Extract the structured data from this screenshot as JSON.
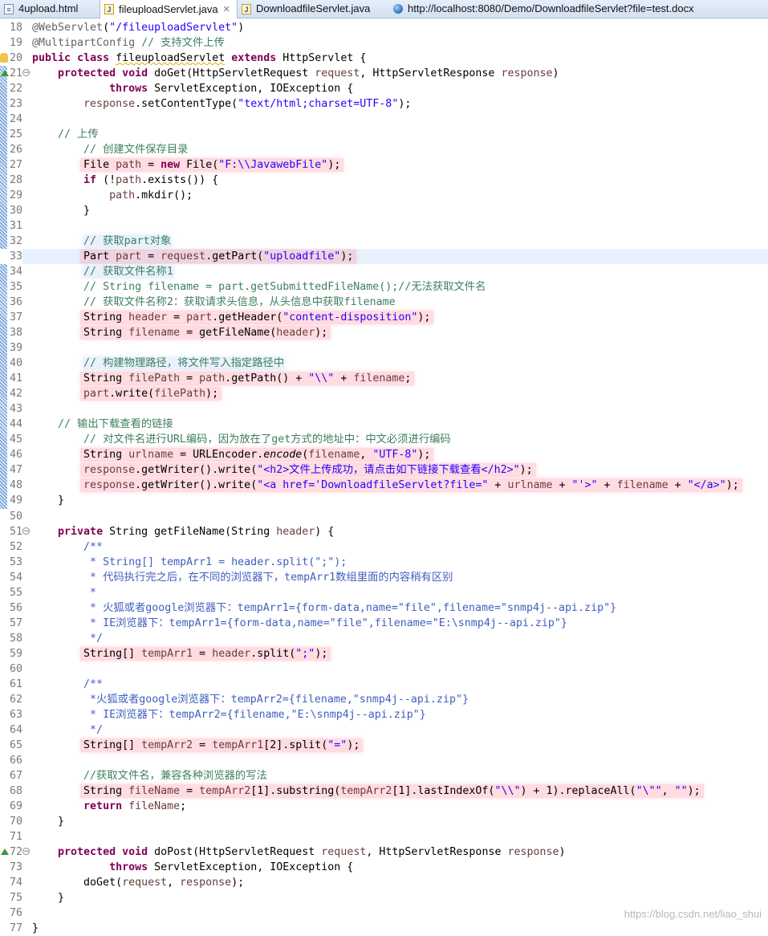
{
  "tabs": [
    {
      "label": "4upload.html",
      "icon": "html-file-icon"
    },
    {
      "label": "fileuploadServlet.java",
      "icon": "java-file-icon",
      "active": true,
      "close": "✕"
    },
    {
      "label": "DownloadfileServlet.java",
      "icon": "java-file-icon"
    },
    {
      "label": "http://localhost:8080/Demo/DownloadfileServlet?file=test.docx",
      "icon": "globe-icon"
    }
  ],
  "editor": {
    "current_line": 33,
    "lines": [
      {
        "no": 18,
        "t": [
          [
            "a",
            "@WebServlet"
          ],
          [
            "n",
            "("
          ],
          [
            "s",
            "\"/fileuploadServlet\""
          ],
          [
            "n",
            ")"
          ]
        ]
      },
      {
        "no": 19,
        "t": [
          [
            "a",
            "@MultipartConfig"
          ],
          [
            "n",
            " "
          ],
          [
            "c",
            "// 支持文件上传"
          ]
        ]
      },
      {
        "no": 20,
        "t": [
          [
            "k",
            "public"
          ],
          [
            "n",
            " "
          ],
          [
            "k",
            "class"
          ],
          [
            "n",
            " "
          ],
          [
            "u",
            "fileuploadServlet"
          ],
          [
            "n",
            " "
          ],
          [
            "k",
            "extends"
          ],
          [
            "n",
            " HttpServlet {"
          ]
        ]
      },
      {
        "no": 21,
        "t": [
          [
            "n",
            "    "
          ],
          [
            "k",
            "protected"
          ],
          [
            "n",
            " "
          ],
          [
            "k",
            "void"
          ],
          [
            "n",
            " doGet(HttpServletRequest "
          ],
          [
            "v",
            "request"
          ],
          [
            "n",
            ", HttpServletResponse "
          ],
          [
            "v",
            "response"
          ],
          [
            "n",
            ")"
          ]
        ]
      },
      {
        "no": 22,
        "t": [
          [
            "n",
            "            "
          ],
          [
            "k",
            "throws"
          ],
          [
            "n",
            " ServletException, IOException {"
          ]
        ]
      },
      {
        "no": 23,
        "t": [
          [
            "n",
            "        "
          ],
          [
            "v",
            "response"
          ],
          [
            "n",
            ".setContentType("
          ],
          [
            "s",
            "\"text/html;charset=UTF-8\""
          ],
          [
            "n",
            ");"
          ]
        ]
      },
      {
        "no": 24,
        "t": []
      },
      {
        "no": 25,
        "t": [
          [
            "n",
            "    "
          ],
          [
            "c",
            "// 上传"
          ]
        ]
      },
      {
        "no": 26,
        "t": [
          [
            "n",
            "        "
          ],
          [
            "c",
            "// 创建文件保存目录"
          ]
        ]
      },
      {
        "no": 27,
        "t": [
          [
            "n",
            "        "
          ],
          [
            "H",
            ""
          ],
          [
            "n",
            "File "
          ],
          [
            "v",
            "path"
          ],
          [
            "n",
            " = "
          ],
          [
            "k",
            "new"
          ],
          [
            "n",
            " File("
          ],
          [
            "s",
            "\"F:\\\\JavawebFile\""
          ],
          [
            "n",
            ");"
          ]
        ]
      },
      {
        "no": 28,
        "t": [
          [
            "n",
            "        "
          ],
          [
            "k",
            "if"
          ],
          [
            "n",
            " (!"
          ],
          [
            "v",
            "path"
          ],
          [
            "n",
            ".exists()) {"
          ]
        ]
      },
      {
        "no": 29,
        "t": [
          [
            "n",
            "            "
          ],
          [
            "v",
            "path"
          ],
          [
            "n",
            ".mkdir();"
          ]
        ]
      },
      {
        "no": 30,
        "t": [
          [
            "n",
            "        }"
          ]
        ]
      },
      {
        "no": 31,
        "t": []
      },
      {
        "no": 32,
        "t": [
          [
            "n",
            "        "
          ],
          [
            "G",
            ""
          ],
          [
            "c",
            "// 获取part对象"
          ]
        ]
      },
      {
        "no": 33,
        "t": [
          [
            "n",
            "        "
          ],
          [
            "H",
            ""
          ],
          [
            "n",
            "Part "
          ],
          [
            "v",
            "part"
          ],
          [
            "n",
            " = "
          ],
          [
            "v",
            "request"
          ],
          [
            "n",
            ".getPart("
          ],
          [
            "s",
            "\"uploadfile\""
          ],
          [
            "n",
            ");"
          ]
        ]
      },
      {
        "no": 34,
        "t": [
          [
            "n",
            "        "
          ],
          [
            "G",
            ""
          ],
          [
            "c",
            "// 获取文件名称1"
          ]
        ]
      },
      {
        "no": 35,
        "t": [
          [
            "n",
            "        "
          ],
          [
            "c",
            "// String filename = part.getSubmittedFileName();//无法获取文件名"
          ]
        ]
      },
      {
        "no": 36,
        "t": [
          [
            "n",
            "        "
          ],
          [
            "c",
            "// 获取文件名称2：获取请求头信息，从头信息中获取filename"
          ]
        ]
      },
      {
        "no": 37,
        "t": [
          [
            "n",
            "        "
          ],
          [
            "H",
            ""
          ],
          [
            "n",
            "String "
          ],
          [
            "v",
            "header"
          ],
          [
            "n",
            " = "
          ],
          [
            "v",
            "part"
          ],
          [
            "n",
            ".getHeader("
          ],
          [
            "s",
            "\"content-disposition\""
          ],
          [
            "n",
            ");"
          ]
        ]
      },
      {
        "no": 38,
        "t": [
          [
            "n",
            "        "
          ],
          [
            "H",
            ""
          ],
          [
            "n",
            "String "
          ],
          [
            "v",
            "filename"
          ],
          [
            "n",
            " = getFileName("
          ],
          [
            "v",
            "header"
          ],
          [
            "n",
            ");"
          ]
        ]
      },
      {
        "no": 39,
        "t": []
      },
      {
        "no": 40,
        "t": [
          [
            "n",
            "        "
          ],
          [
            "G",
            ""
          ],
          [
            "c",
            "// 构建物理路径，将文件写入指定路径中"
          ]
        ]
      },
      {
        "no": 41,
        "t": [
          [
            "n",
            "        "
          ],
          [
            "H",
            ""
          ],
          [
            "n",
            "String "
          ],
          [
            "v",
            "filePath"
          ],
          [
            "n",
            " = "
          ],
          [
            "v",
            "path"
          ],
          [
            "n",
            ".getPath() + "
          ],
          [
            "s",
            "\"\\\\\""
          ],
          [
            "n",
            " + "
          ],
          [
            "v",
            "filename"
          ],
          [
            "n",
            ";"
          ]
        ]
      },
      {
        "no": 42,
        "t": [
          [
            "n",
            "        "
          ],
          [
            "H",
            ""
          ],
          [
            "v",
            "part"
          ],
          [
            "n",
            ".write("
          ],
          [
            "v",
            "filePath"
          ],
          [
            "n",
            ");"
          ]
        ]
      },
      {
        "no": 43,
        "t": []
      },
      {
        "no": 44,
        "t": [
          [
            "n",
            "    "
          ],
          [
            "c",
            "// 输出下载查看的链接"
          ]
        ]
      },
      {
        "no": 45,
        "t": [
          [
            "n",
            "        "
          ],
          [
            "c",
            "// 对文件名进行URL编码，因为放在了get方式的地址中：中文必须进行编码"
          ]
        ]
      },
      {
        "no": 46,
        "t": [
          [
            "n",
            "        "
          ],
          [
            "H",
            ""
          ],
          [
            "n",
            "String "
          ],
          [
            "v",
            "urlname"
          ],
          [
            "n",
            " = URLEncoder."
          ],
          [
            "i",
            "encode"
          ],
          [
            "n",
            "("
          ],
          [
            "v",
            "filename"
          ],
          [
            "n",
            ", "
          ],
          [
            "s",
            "\"UTF-8\""
          ],
          [
            "n",
            ");"
          ]
        ]
      },
      {
        "no": 47,
        "t": [
          [
            "n",
            "        "
          ],
          [
            "H",
            ""
          ],
          [
            "v",
            "response"
          ],
          [
            "n",
            ".getWriter().write("
          ],
          [
            "s",
            "\"<h2>文件上传成功，请点击如下链接下载查看</h2>\""
          ],
          [
            "n",
            ");"
          ]
        ]
      },
      {
        "no": 48,
        "t": [
          [
            "n",
            "        "
          ],
          [
            "H",
            ""
          ],
          [
            "v",
            "response"
          ],
          [
            "n",
            ".getWriter().write("
          ],
          [
            "s",
            "\"<a href='DownloadfileServlet?file=\""
          ],
          [
            "n",
            " + "
          ],
          [
            "v",
            "urlname"
          ],
          [
            "n",
            " + "
          ],
          [
            "s",
            "\"'>\""
          ],
          [
            "n",
            " + "
          ],
          [
            "v",
            "filename"
          ],
          [
            "n",
            " + "
          ],
          [
            "s",
            "\"</a>\""
          ],
          [
            "n",
            ");"
          ]
        ]
      },
      {
        "no": 49,
        "t": [
          [
            "n",
            "    }"
          ]
        ]
      },
      {
        "no": 50,
        "t": []
      },
      {
        "no": 51,
        "t": [
          [
            "n",
            "    "
          ],
          [
            "k",
            "private"
          ],
          [
            "n",
            " String getFileName(String "
          ],
          [
            "v",
            "header"
          ],
          [
            "n",
            ") {"
          ]
        ]
      },
      {
        "no": 52,
        "t": [
          [
            "n",
            "        "
          ],
          [
            "d",
            "/**"
          ]
        ]
      },
      {
        "no": 53,
        "t": [
          [
            "n",
            "        "
          ],
          [
            "d",
            " * String[] tempArr1 = header.split(\";\");"
          ]
        ]
      },
      {
        "no": 54,
        "t": [
          [
            "n",
            "        "
          ],
          [
            "d",
            " * 代码执行完之后，在不同的浏览器下，tempArr1数组里面的内容稍有区别"
          ]
        ]
      },
      {
        "no": 55,
        "t": [
          [
            "n",
            "        "
          ],
          [
            "d",
            " *"
          ]
        ]
      },
      {
        "no": 56,
        "t": [
          [
            "n",
            "        "
          ],
          [
            "d",
            " * 火狐或者google浏览器下：tempArr1={form-data,name=\"file\",filename=\"snmp4j--api.zip\"}"
          ]
        ]
      },
      {
        "no": 57,
        "t": [
          [
            "n",
            "        "
          ],
          [
            "d",
            " * IE浏览器下：tempArr1={form-data,name=\"file\",filename=\"E:\\snmp4j--api.zip\"}"
          ]
        ]
      },
      {
        "no": 58,
        "t": [
          [
            "n",
            "        "
          ],
          [
            "d",
            " */"
          ]
        ]
      },
      {
        "no": 59,
        "t": [
          [
            "n",
            "        "
          ],
          [
            "H",
            ""
          ],
          [
            "n",
            "String[] "
          ],
          [
            "v",
            "tempArr1"
          ],
          [
            "n",
            " = "
          ],
          [
            "v",
            "header"
          ],
          [
            "n",
            ".split("
          ],
          [
            "s",
            "\";\""
          ],
          [
            "n",
            ");"
          ]
        ]
      },
      {
        "no": 60,
        "t": []
      },
      {
        "no": 61,
        "t": [
          [
            "n",
            "        "
          ],
          [
            "d",
            "/**"
          ]
        ]
      },
      {
        "no": 62,
        "t": [
          [
            "n",
            "        "
          ],
          [
            "d",
            " *火狐或者google浏览器下：tempArr2={filename,\"snmp4j--api.zip\"}"
          ]
        ]
      },
      {
        "no": 63,
        "t": [
          [
            "n",
            "        "
          ],
          [
            "d",
            " * IE浏览器下：tempArr2={filename,\"E:\\snmp4j--api.zip\"}"
          ]
        ]
      },
      {
        "no": 64,
        "t": [
          [
            "n",
            "        "
          ],
          [
            "d",
            " */"
          ]
        ]
      },
      {
        "no": 65,
        "t": [
          [
            "n",
            "        "
          ],
          [
            "H",
            ""
          ],
          [
            "n",
            "String[] "
          ],
          [
            "v",
            "tempArr2"
          ],
          [
            "n",
            " = "
          ],
          [
            "v",
            "tempArr1"
          ],
          [
            "n",
            "[2].split("
          ],
          [
            "s",
            "\"=\""
          ],
          [
            "n",
            ");"
          ]
        ]
      },
      {
        "no": 66,
        "t": []
      },
      {
        "no": 67,
        "t": [
          [
            "n",
            "        "
          ],
          [
            "c",
            "//获取文件名，兼容各种浏览器的写法"
          ]
        ]
      },
      {
        "no": 68,
        "t": [
          [
            "n",
            "        "
          ],
          [
            "H",
            ""
          ],
          [
            "n",
            "String "
          ],
          [
            "v",
            "fileName"
          ],
          [
            "n",
            " = "
          ],
          [
            "v",
            "tempArr2"
          ],
          [
            "n",
            "[1].substring("
          ],
          [
            "v",
            "tempArr2"
          ],
          [
            "n",
            "[1].lastIndexOf("
          ],
          [
            "s",
            "\"\\\\\""
          ],
          [
            "n",
            ") + 1).replaceAll("
          ],
          [
            "s",
            "\"\\\"\""
          ],
          [
            "n",
            ", "
          ],
          [
            "s",
            "\"\""
          ],
          [
            "n",
            ");"
          ]
        ]
      },
      {
        "no": 69,
        "t": [
          [
            "n",
            "        "
          ],
          [
            "k",
            "return"
          ],
          [
            "n",
            " "
          ],
          [
            "v",
            "fileName"
          ],
          [
            "n",
            ";"
          ]
        ]
      },
      {
        "no": 70,
        "t": [
          [
            "n",
            "    }"
          ]
        ]
      },
      {
        "no": 71,
        "t": []
      },
      {
        "no": 72,
        "t": [
          [
            "n",
            "    "
          ],
          [
            "k",
            "protected"
          ],
          [
            "n",
            " "
          ],
          [
            "k",
            "void"
          ],
          [
            "n",
            " doPost(HttpServletRequest "
          ],
          [
            "v",
            "request"
          ],
          [
            "n",
            ", HttpServletResponse "
          ],
          [
            "v",
            "response"
          ],
          [
            "n",
            ")"
          ]
        ]
      },
      {
        "no": 73,
        "t": [
          [
            "n",
            "            "
          ],
          [
            "k",
            "throws"
          ],
          [
            "n",
            " ServletException, IOException {"
          ]
        ]
      },
      {
        "no": 74,
        "t": [
          [
            "n",
            "        doGet("
          ],
          [
            "v",
            "request"
          ],
          [
            "n",
            ", "
          ],
          [
            "v",
            "response"
          ],
          [
            "n",
            ");"
          ]
        ]
      },
      {
        "no": 75,
        "t": [
          [
            "n",
            "    }"
          ]
        ]
      },
      {
        "no": 76,
        "t": []
      },
      {
        "no": 77,
        "t": [
          [
            "n",
            "}"
          ]
        ]
      }
    ]
  },
  "watermark": "https://blog.csdn.net/liao_shui",
  "colors": {
    "keyword": "#7f0055",
    "string": "#2a00ff",
    "comment": "#3f7f5f",
    "javadoc": "#3f5fbf",
    "variable": "#6a3e3e",
    "current_line": "#e8f2fe",
    "highlight": "#ff8c9b"
  }
}
